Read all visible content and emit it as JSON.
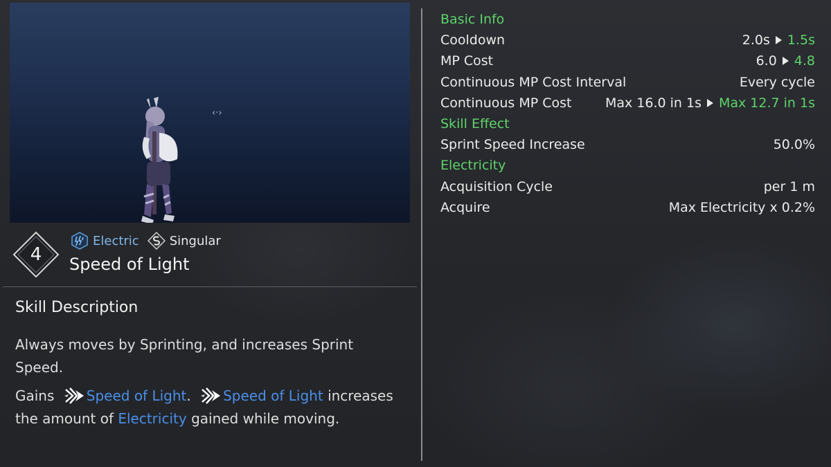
{
  "preview": {
    "drag_hint": "‹·›"
  },
  "skill": {
    "level": "4",
    "tags": [
      {
        "label": "Electric",
        "icon": "electric-icon"
      },
      {
        "label": "Singular",
        "icon": "singular-icon"
      }
    ],
    "name": "Speed of Light"
  },
  "description": {
    "title": "Skill Description",
    "line1": "Always moves by Sprinting, and increases Sprint Speed.",
    "gains_prefix": "Gains",
    "buff_name": "Speed of Light",
    "period": ".",
    "buff_name_2": "Speed of Light",
    "rest_1": "increases the amount of",
    "electricity": "Electricity",
    "rest_2": "gained while moving."
  },
  "stats": {
    "basic_info": "Basic Info",
    "cooldown": {
      "label": "Cooldown",
      "old": "2.0s",
      "new": "1.5s"
    },
    "mp_cost": {
      "label": "MP Cost",
      "old": "6.0",
      "new": "4.8"
    },
    "mp_interval": {
      "label": "Continuous MP Cost Interval",
      "value": "Every cycle"
    },
    "cont_mp": {
      "label": "Continuous MP Cost",
      "old": "Max 16.0 in 1s",
      "new": "Max 12.7 in 1s"
    },
    "skill_effect": "Skill Effect",
    "sprint": {
      "label": "Sprint Speed Increase",
      "value": "50.0%"
    },
    "electricity": "Electricity",
    "acq_cycle": {
      "label": "Acquisition Cycle",
      "value": "per 1 m"
    },
    "acquire": {
      "label": "Acquire",
      "value": "Max Electricity x 0.2%"
    }
  },
  "colors": {
    "section_green": "#5fd36a",
    "highlight_blue": "#4b8fe8",
    "electric_tag": "#7fb8e8"
  }
}
